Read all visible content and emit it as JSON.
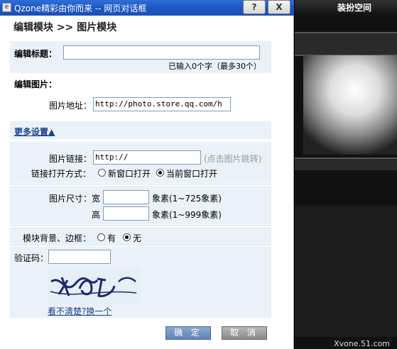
{
  "window": {
    "title": "Qzone精彩由你而来 -- 网页对话框",
    "help": "?",
    "close": "X"
  },
  "heading": "编辑模块 >> 图片模块",
  "title_section": {
    "label": "编辑标题：",
    "value": "",
    "counter": "已输入0个字（最多30个）"
  },
  "image_section": {
    "label": "编辑图片：",
    "url_label": "图片地址：",
    "url_value": "http://photo.store.qq.com/h"
  },
  "more_settings": "更多设置",
  "link_section": {
    "link_label": "图片链接：",
    "link_value": "http://",
    "link_hint": "(点击图片跳转)",
    "open_label": "链接打开方式：",
    "open_new": "新窗口打开",
    "open_current": "当前窗口打开",
    "open_selected": "current"
  },
  "size_section": {
    "label": "图片尺寸：",
    "width_label": "宽",
    "width_value": "",
    "width_hint": "象素(1~725象素)",
    "height_label": "高",
    "height_value": "",
    "height_hint": "象素(1~999象素)"
  },
  "border_section": {
    "label": "模块背景、边框：",
    "yes": "有",
    "no": "无",
    "selected": "no"
  },
  "verify": {
    "label": "验证码：",
    "value": "",
    "refresh": "看不清楚?换一个"
  },
  "buttons": {
    "ok": "确 定",
    "cancel": "取 消"
  },
  "background": {
    "dress_up": "装扮空间",
    "watermark": "Xvone.51.com"
  }
}
